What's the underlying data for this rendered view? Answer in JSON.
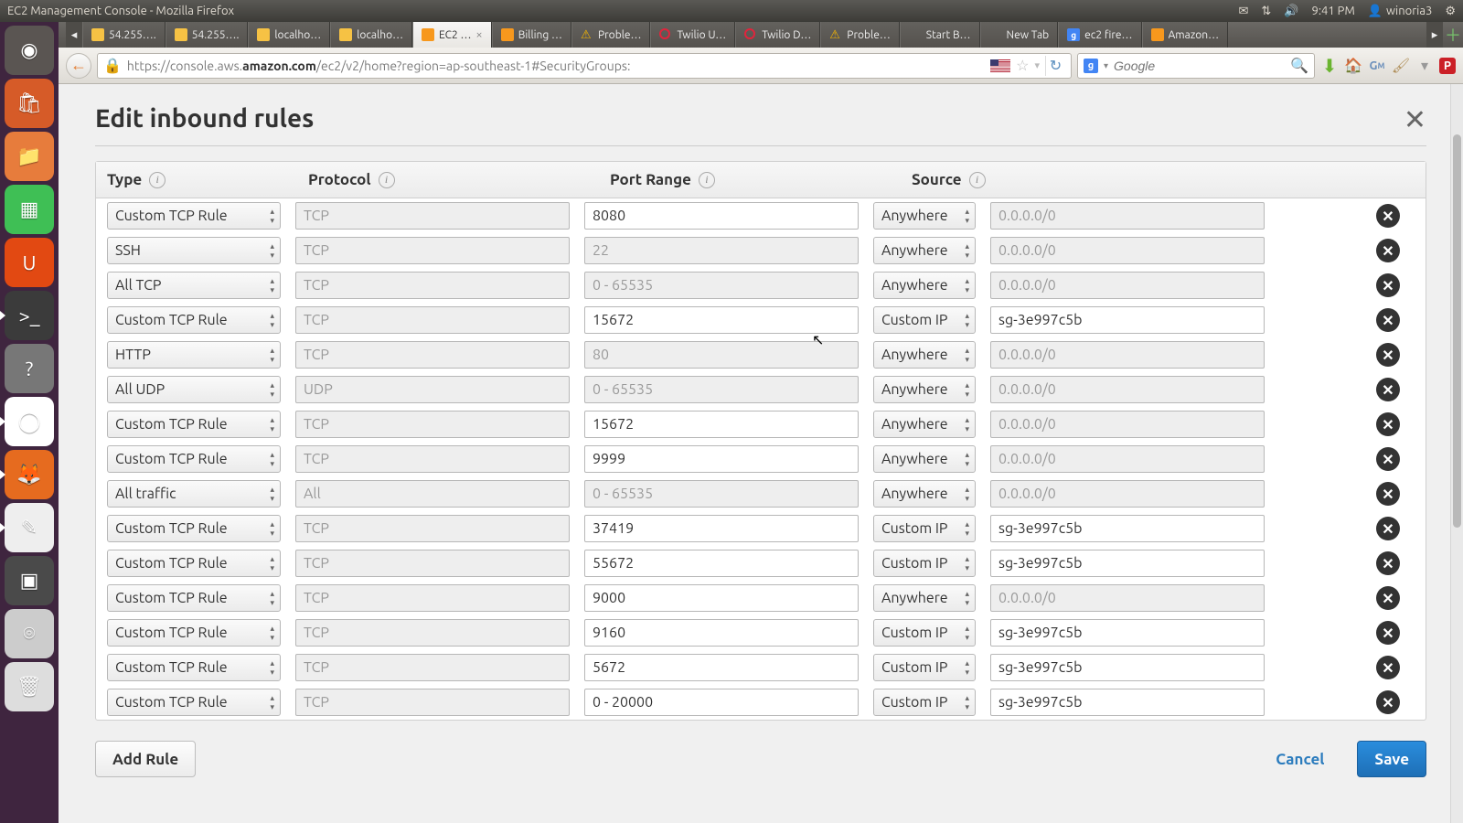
{
  "os": {
    "window_title": "EC2 Management Console - Mozilla Firefox",
    "time": "9:41 PM",
    "user": "winoria3"
  },
  "launcher": [
    {
      "name": "dash",
      "color": "#5a5552",
      "glyph": "◉",
      "active": false
    },
    {
      "name": "software-center",
      "color": "#d65b28",
      "glyph": "🛍",
      "active": false
    },
    {
      "name": "files",
      "color": "#e77c3c",
      "glyph": "📁",
      "active": false
    },
    {
      "name": "libreoffice-calc",
      "color": "#3fbf55",
      "glyph": "▦",
      "active": false
    },
    {
      "name": "ubuntu-one",
      "color": "#e24912",
      "glyph": "U",
      "active": false
    },
    {
      "name": "terminal",
      "color": "#3b3b3b",
      "glyph": ">_",
      "active": true
    },
    {
      "name": "help",
      "color": "#777",
      "glyph": "?",
      "active": false
    },
    {
      "name": "chrome",
      "color": "#fff",
      "glyph": "◯",
      "active": true
    },
    {
      "name": "firefox",
      "color": "#e66b1f",
      "glyph": "🦊",
      "active": true
    },
    {
      "name": "gedit",
      "color": "#eee",
      "glyph": "✎",
      "active": true
    },
    {
      "name": "screenshot",
      "color": "#4a4a4a",
      "glyph": "▣",
      "active": false
    },
    {
      "name": "disk",
      "color": "#ccc",
      "glyph": "⌾",
      "active": false
    },
    {
      "name": "trash",
      "color": "#ddd",
      "glyph": "🗑",
      "active": false
    }
  ],
  "tabs": [
    {
      "label": "54.255….",
      "icon": "pma",
      "active": false
    },
    {
      "label": "54.255….",
      "icon": "pma",
      "active": false
    },
    {
      "label": "localho…",
      "icon": "pma",
      "active": false
    },
    {
      "label": "localho…",
      "icon": "pma",
      "active": false
    },
    {
      "label": "EC2 …",
      "icon": "aws",
      "active": true,
      "close": true
    },
    {
      "label": "Billing …",
      "icon": "aws",
      "active": false
    },
    {
      "label": "Proble…",
      "icon": "warn",
      "active": false
    },
    {
      "label": "Twilio U…",
      "icon": "twilio",
      "active": false
    },
    {
      "label": "Twilio D…",
      "icon": "twilio",
      "active": false
    },
    {
      "label": "Proble…",
      "icon": "warn",
      "active": false
    },
    {
      "label": "Start B…",
      "icon": "none",
      "active": false
    },
    {
      "label": "New Tab",
      "icon": "none",
      "active": false
    },
    {
      "label": "ec2 fire…",
      "icon": "google",
      "active": false
    },
    {
      "label": "Amazon…",
      "icon": "aws",
      "active": false
    }
  ],
  "url": {
    "prefix": "https://console.aws.",
    "bold": "amazon.com",
    "suffix": "/ec2/v2/home?region=ap-southeast-1#SecurityGroups:"
  },
  "search_placeholder": "Google",
  "modal": {
    "title": "Edit inbound rules",
    "columns": {
      "type": "Type",
      "protocol": "Protocol",
      "port": "Port Range",
      "source": "Source"
    },
    "add_rule": "Add Rule",
    "cancel": "Cancel",
    "save": "Save"
  },
  "rules": [
    {
      "type": "Custom TCP Rule",
      "proto": "TCP",
      "port": "8080",
      "port_editable": true,
      "source": "Anywhere",
      "cidr": "0.0.0.0/0",
      "cidr_editable": false
    },
    {
      "type": "SSH",
      "proto": "TCP",
      "port": "22",
      "port_editable": false,
      "source": "Anywhere",
      "cidr": "0.0.0.0/0",
      "cidr_editable": false
    },
    {
      "type": "All TCP",
      "proto": "TCP",
      "port": "0 - 65535",
      "port_editable": false,
      "source": "Anywhere",
      "cidr": "0.0.0.0/0",
      "cidr_editable": false
    },
    {
      "type": "Custom TCP Rule",
      "proto": "TCP",
      "port": "15672",
      "port_editable": true,
      "source": "Custom IP",
      "cidr": "sg-3e997c5b",
      "cidr_editable": true
    },
    {
      "type": "HTTP",
      "proto": "TCP",
      "port": "80",
      "port_editable": false,
      "source": "Anywhere",
      "cidr": "0.0.0.0/0",
      "cidr_editable": false
    },
    {
      "type": "All UDP",
      "proto": "UDP",
      "port": "0 - 65535",
      "port_editable": false,
      "source": "Anywhere",
      "cidr": "0.0.0.0/0",
      "cidr_editable": false
    },
    {
      "type": "Custom TCP Rule",
      "proto": "TCP",
      "port": "15672",
      "port_editable": true,
      "source": "Anywhere",
      "cidr": "0.0.0.0/0",
      "cidr_editable": false
    },
    {
      "type": "Custom TCP Rule",
      "proto": "TCP",
      "port": "9999",
      "port_editable": true,
      "source": "Anywhere",
      "cidr": "0.0.0.0/0",
      "cidr_editable": false
    },
    {
      "type": "All traffic",
      "proto": "All",
      "port": "0 - 65535",
      "port_editable": false,
      "source": "Anywhere",
      "cidr": "0.0.0.0/0",
      "cidr_editable": false
    },
    {
      "type": "Custom TCP Rule",
      "proto": "TCP",
      "port": "37419",
      "port_editable": true,
      "source": "Custom IP",
      "cidr": "sg-3e997c5b",
      "cidr_editable": true
    },
    {
      "type": "Custom TCP Rule",
      "proto": "TCP",
      "port": "55672",
      "port_editable": true,
      "source": "Custom IP",
      "cidr": "sg-3e997c5b",
      "cidr_editable": true
    },
    {
      "type": "Custom TCP Rule",
      "proto": "TCP",
      "port": "9000",
      "port_editable": true,
      "source": "Anywhere",
      "cidr": "0.0.0.0/0",
      "cidr_editable": false
    },
    {
      "type": "Custom TCP Rule",
      "proto": "TCP",
      "port": "9160",
      "port_editable": true,
      "source": "Custom IP",
      "cidr": "sg-3e997c5b",
      "cidr_editable": true
    },
    {
      "type": "Custom TCP Rule",
      "proto": "TCP",
      "port": "5672",
      "port_editable": true,
      "source": "Custom IP",
      "cidr": "sg-3e997c5b",
      "cidr_editable": true
    },
    {
      "type": "Custom TCP Rule",
      "proto": "TCP",
      "port": "0 - 20000",
      "port_editable": true,
      "source": "Custom IP",
      "cidr": "sg-3e997c5b",
      "cidr_editable": true
    }
  ]
}
